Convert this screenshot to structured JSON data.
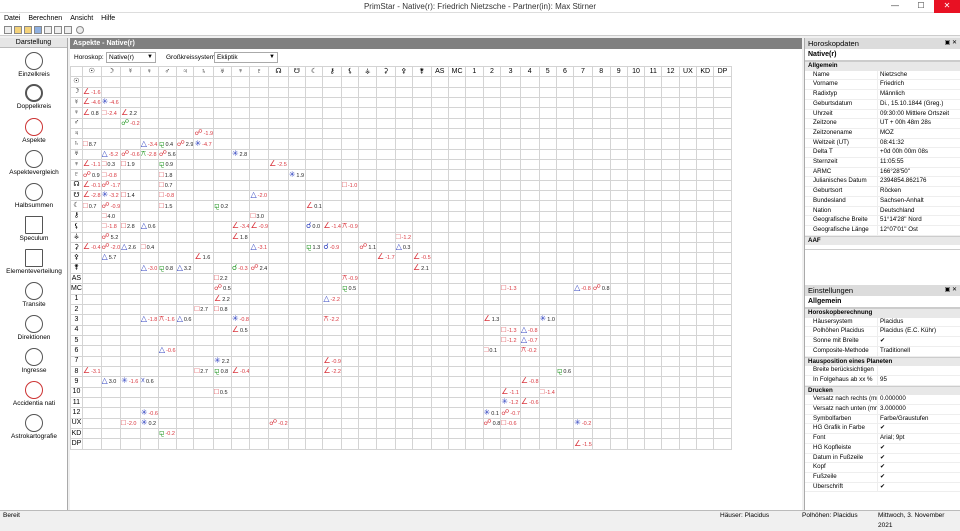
{
  "window": {
    "title": "PrimStar - Native(r): Friedrich Nietzsche - Partner(in): Max Stirner",
    "min": "—",
    "max": "☐",
    "close": "✕"
  },
  "menu": [
    "Datei",
    "Berechnen",
    "Ansicht",
    "Hilfe"
  ],
  "left": {
    "header": "Darstellung",
    "items": [
      {
        "label": "Einzelkreis",
        "icon": "single-circle-icon"
      },
      {
        "label": "Doppelkreis",
        "icon": "double-circle-icon"
      },
      {
        "label": "Aspekte",
        "icon": "aspects-icon"
      },
      {
        "label": "Aspektevergleich",
        "icon": "aspect-comparison-icon"
      },
      {
        "label": "Halbsummen",
        "icon": "midpoints-icon"
      },
      {
        "label": "Speculum",
        "icon": "speculum-icon"
      },
      {
        "label": "Elementeverteilung",
        "icon": "element-distribution-icon"
      },
      {
        "label": "Transite",
        "icon": "transits-icon"
      },
      {
        "label": "Direktionen",
        "icon": "directions-icon"
      },
      {
        "label": "Ingresse",
        "icon": "ingresses-icon"
      },
      {
        "label": "Accidentia nati",
        "icon": "accidentia-icon"
      },
      {
        "label": "Astrokartografie",
        "icon": "astrocartography-icon"
      }
    ]
  },
  "center": {
    "title": "Aspekte - Native(r)",
    "horoskop_label": "Horoskop:",
    "horoskop_value": "Native(r)",
    "kreis_label": "Großkreissystem:",
    "kreis_value": "Ekliptik",
    "col_headers": [
      "☉",
      "☽",
      "☿",
      "♀",
      "♂",
      "♃",
      "♄",
      "♅",
      "♆",
      "♇",
      "☊",
      "☋",
      "☾",
      "⚷",
      "⚸",
      "⚶",
      "⚳",
      "⚴",
      "⚵",
      "AS",
      "MC",
      "1",
      "2",
      "3",
      "4",
      "5",
      "6",
      "7",
      "8",
      "9",
      "10",
      "11",
      "12",
      "UX",
      "KD",
      "DP"
    ],
    "row_headers": [
      "☉",
      "☽",
      "☿",
      "♀",
      "♂",
      "♃",
      "♄",
      "♅",
      "♆",
      "♇",
      "☊",
      "☋",
      "☾",
      "⚷",
      "⚸",
      "⚶",
      "⚳",
      "⚴",
      "⚵",
      "AS",
      "MC",
      "1",
      "2",
      "3",
      "4",
      "5",
      "6",
      "7",
      "8",
      "9",
      "10",
      "11",
      "12",
      "UX",
      "KD",
      "DP"
    ],
    "cells": [
      [],
      [
        [
          0,
          "∠",
          "-1.6",
          "red"
        ]
      ],
      [
        [
          0,
          "∠",
          "-4.6",
          "red"
        ],
        [
          1,
          "✳",
          "-4.6",
          "blue"
        ]
      ],
      [
        [
          0,
          "∠",
          "0.8",
          "red"
        ],
        [
          1,
          "□",
          "-2.4",
          "red"
        ],
        [
          2,
          "∠",
          "2.2",
          "red"
        ]
      ],
      [
        [
          2,
          "☍",
          "-0.2",
          "green"
        ]
      ],
      [
        [
          6,
          "☍",
          "-1.9",
          "red"
        ]
      ],
      [
        [
          0,
          "□",
          "8.7",
          "red"
        ],
        [
          3,
          "△",
          "-3.4",
          "blue"
        ],
        [
          4,
          "⚼",
          "0.4",
          "green"
        ],
        [
          5,
          "☍",
          "2.9",
          "red"
        ],
        [
          6,
          "✳",
          "-4.7",
          "blue"
        ]
      ],
      [
        [
          1,
          "△",
          "-5.2",
          "blue"
        ],
        [
          2,
          "☍",
          "-0.6",
          "red"
        ],
        [
          3,
          "⚻",
          "-2.8",
          "green"
        ],
        [
          4,
          "☍",
          "5.6",
          "red"
        ],
        [
          8,
          "✳",
          "2.8",
          "blue"
        ]
      ],
      [
        [
          0,
          "∠",
          "-1.1",
          "red"
        ],
        [
          1,
          "□",
          "0.3",
          "red"
        ],
        [
          2,
          "□",
          "1.9",
          "red"
        ],
        [
          4,
          "⚼",
          "0.9",
          "green"
        ],
        [
          10,
          "∠",
          "-2.5",
          "red"
        ]
      ],
      [
        [
          0,
          "☍",
          "0.9",
          "red"
        ],
        [
          1,
          "□",
          "-0.8",
          "red"
        ],
        [
          4,
          "□",
          "1.8",
          "red"
        ],
        [
          11,
          "✳",
          "1.9",
          "blue"
        ]
      ],
      [
        [
          0,
          "∠",
          "-0.1",
          "red"
        ],
        [
          1,
          "☍",
          "-1.7",
          "red"
        ],
        [
          4,
          "□",
          "0.7",
          "red"
        ],
        [
          14,
          "□",
          "-1.0",
          "red"
        ]
      ],
      [
        [
          0,
          "∠",
          "-2.8",
          "red"
        ],
        [
          1,
          "✳",
          "-3.2",
          "blue"
        ],
        [
          2,
          "□",
          "1.4",
          "red"
        ],
        [
          4,
          "□",
          "-0.8",
          "red"
        ],
        [
          9,
          "△",
          "-2.0",
          "blue"
        ]
      ],
      [
        [
          0,
          "□",
          "0.7",
          "red"
        ],
        [
          1,
          "☍",
          "-0.9",
          "red"
        ],
        [
          4,
          "□",
          "1.5",
          "red"
        ],
        [
          7,
          "⚼",
          "0.2",
          "green"
        ],
        [
          12,
          "∠",
          "0.1",
          "red"
        ]
      ],
      [
        [
          1,
          "□",
          "4.0",
          "red"
        ],
        [
          9,
          "□",
          "3.0",
          "red"
        ]
      ],
      [
        [
          1,
          "□",
          "-1.8",
          "red"
        ],
        [
          2,
          "□",
          "2.8",
          "red"
        ],
        [
          3,
          "△",
          "0.6",
          "blue"
        ],
        [
          8,
          "∠",
          "-3.4",
          "red"
        ],
        [
          9,
          "∠",
          "-0.9",
          "red"
        ],
        [
          12,
          "☌",
          "0.0",
          "blue"
        ],
        [
          13,
          "∠",
          "-1.4",
          "red"
        ],
        [
          14,
          "⚻",
          "-0.9",
          "red"
        ]
      ],
      [
        [
          1,
          "☍",
          "5.2",
          "red"
        ],
        [
          8,
          "∠",
          "1.8",
          "red"
        ],
        [
          17,
          "□",
          "-1.2",
          "red"
        ]
      ],
      [
        [
          0,
          "∠",
          "-0.4",
          "red"
        ],
        [
          1,
          "☍",
          "-2.0",
          "red"
        ],
        [
          2,
          "△",
          "2.6",
          "blue"
        ],
        [
          3,
          "□",
          "0.4",
          "red"
        ],
        [
          9,
          "△",
          "-3.1",
          "blue"
        ],
        [
          12,
          "⚼",
          "1.3",
          "green"
        ],
        [
          13,
          "☌",
          "-0.9",
          "blue"
        ],
        [
          15,
          "☍",
          "1.1",
          "red"
        ],
        [
          17,
          "△",
          "0.3",
          "blue"
        ]
      ],
      [
        [
          1,
          "△",
          "5.7",
          "blue"
        ],
        [
          6,
          "∠",
          "1.6",
          "red"
        ],
        [
          16,
          "∠",
          "-1.7",
          "red"
        ],
        [
          18,
          "∠",
          "-0.5",
          "red"
        ]
      ],
      [
        [
          3,
          "△",
          "-3.0",
          "blue"
        ],
        [
          4,
          "⚼",
          "0.8",
          "green"
        ],
        [
          5,
          "△",
          "3.2",
          "blue"
        ],
        [
          8,
          "☌",
          "-0.3",
          "green"
        ],
        [
          9,
          "☍",
          "2.4",
          "red"
        ],
        [
          18,
          "∠",
          "2.1",
          "red"
        ]
      ],
      [
        [
          7,
          "□",
          "2.2",
          "red"
        ],
        [
          14,
          "⚻",
          "-0.9",
          "red"
        ]
      ],
      [
        [
          7,
          "☍",
          "0.5",
          "red"
        ],
        [
          14,
          "⚼",
          "0.5",
          "green"
        ],
        [
          23,
          "□",
          "-1.3",
          "red"
        ],
        [
          27,
          "△",
          "-0.8",
          "blue"
        ],
        [
          28,
          "☍",
          "0.8",
          "red"
        ]
      ],
      [
        [
          7,
          "∠",
          "2.2",
          "red"
        ],
        [
          13,
          "△",
          "-2.2",
          "blue"
        ]
      ],
      [
        [
          6,
          "□",
          "2.7",
          "red"
        ],
        [
          7,
          "□",
          "0.8",
          "red"
        ]
      ],
      [
        [
          3,
          "△",
          "-1.8",
          "blue"
        ],
        [
          4,
          "⚻",
          "-1.6",
          "red"
        ],
        [
          5,
          "△",
          "0.6",
          "blue"
        ],
        [
          8,
          "✳",
          "-0.8",
          "blue"
        ],
        [
          13,
          "⚻",
          "-2.2",
          "red"
        ],
        [
          22,
          "∠",
          "1.3",
          "red"
        ],
        [
          25,
          "✳",
          "1.0",
          "blue"
        ]
      ],
      [
        [
          8,
          "∠",
          "0.5",
          "red"
        ],
        [
          23,
          "□",
          "-1.3",
          "red"
        ],
        [
          24,
          "△",
          "-0.8",
          "blue"
        ]
      ],
      [
        [
          23,
          "□",
          "-1.2",
          "red"
        ],
        [
          24,
          "△",
          "-0.7",
          "blue"
        ]
      ],
      [
        [
          4,
          "△",
          "-0.6",
          "blue"
        ],
        [
          22,
          "□",
          "0.1",
          "red"
        ],
        [
          24,
          "⚻",
          "-0.2",
          "red"
        ]
      ],
      [
        [
          7,
          "✳",
          "2.2",
          "blue"
        ],
        [
          13,
          "∠",
          "-0.9",
          "red"
        ]
      ],
      [
        [
          0,
          "∠",
          "-3.1",
          "red"
        ],
        [
          6,
          "□",
          "2.7",
          "red"
        ],
        [
          7,
          "⚼",
          "0.8",
          "green"
        ],
        [
          8,
          "∠",
          "-0.4",
          "red"
        ],
        [
          13,
          "∠",
          "-2.2",
          "red"
        ],
        [
          26,
          "⚼",
          "0.6",
          "green"
        ]
      ],
      [
        [
          1,
          "△",
          "3.0",
          "blue"
        ],
        [
          2,
          "✳",
          "-1.6",
          "blue"
        ],
        [
          3,
          "☓",
          "0.6",
          "blue"
        ],
        [
          24,
          "∠",
          "-0.8",
          "red"
        ]
      ],
      [
        [
          7,
          "□",
          "0.5",
          "red"
        ],
        [
          23,
          "∠",
          "-1.1",
          "red"
        ],
        [
          25,
          "□",
          "-1.4",
          "red"
        ]
      ],
      [
        [
          23,
          "✳",
          "-1.2",
          "blue"
        ],
        [
          24,
          "∠",
          "-0.6",
          "red"
        ]
      ],
      [
        [
          3,
          "✳",
          "-0.6",
          "blue"
        ],
        [
          22,
          "✳",
          "0.1",
          "blue"
        ],
        [
          23,
          "☍",
          "-0.7",
          "red"
        ]
      ],
      [
        [
          2,
          "□",
          "-2.0",
          "red"
        ],
        [
          3,
          "✳",
          "0.2",
          "blue"
        ],
        [
          10,
          "☍",
          "-0.2",
          "red"
        ],
        [
          22,
          "☍",
          "0.8",
          "red"
        ],
        [
          23,
          "□",
          "-0.6",
          "red"
        ],
        [
          27,
          "✳",
          "-0.2",
          "blue"
        ]
      ],
      [
        [
          4,
          "⚼",
          "-0.2",
          "green"
        ]
      ],
      [
        [
          27,
          "∠",
          "-1.5",
          "red"
        ]
      ]
    ]
  },
  "horoscope": {
    "header": "Horoskopdaten",
    "sub": "Native(r)",
    "section": "Allgemein",
    "rows": [
      [
        "Name",
        "Nietzsche"
      ],
      [
        "Vorname",
        "Friedrich"
      ],
      [
        "Radixtyp",
        "Männlich"
      ],
      [
        "Geburtsdatum",
        "Di., 15.10.1844 (Greg.)"
      ],
      [
        "Uhrzeit",
        "09:30:00 Mittlere Ortszeit"
      ],
      [
        "Zeitzone",
        "UT + 00h 48m 28s"
      ],
      [
        "Zeitzonename",
        "MOZ"
      ],
      [
        "Weltzeit (UT)",
        "08:41:32"
      ],
      [
        "Delta T",
        "+0d 00h 00m 08s"
      ],
      [
        "Sternzeit",
        "11:05:55"
      ],
      [
        "ARMC",
        "166°28'50\""
      ],
      [
        "Julianisches Datum",
        "2394854.862176"
      ],
      [
        "Geburtsort",
        "Röcken"
      ],
      [
        "Bundesland",
        "Sachsen-Anhalt"
      ],
      [
        "Nation",
        "Deutschland"
      ],
      [
        "Geografische Breite",
        "51°14'28\" Nord"
      ],
      [
        "Geografische Länge",
        "12°07'01\" Ost"
      ]
    ],
    "more": "AAF"
  },
  "settings": {
    "header": "Einstellungen",
    "sub": "Allgemein",
    "sections": [
      {
        "title": "Horoskopberechnung",
        "rows": [
          [
            "Häusersystem",
            "Placidus"
          ],
          [
            "Polhöhen Placidus",
            "Placidus (E.C. Kühr)"
          ],
          [
            "Sonne mit Breite",
            "✔"
          ],
          [
            "Composite-Methode",
            "Traditionell"
          ]
        ]
      },
      {
        "title": "Hausposition eines Planeten",
        "rows": [
          [
            "Breite berücksichtigen",
            ""
          ],
          [
            "In Folgehaus ab xx %",
            "95"
          ]
        ]
      },
      {
        "title": "Drucken",
        "rows": [
          [
            "Versatz nach rechts (mm)",
            "0.000000"
          ],
          [
            "Versatz nach unten (mm)",
            "3.000000"
          ],
          [
            "Symbolfarben",
            "Farbe/Graustufen"
          ],
          [
            "HG Grafik in Farbe",
            "✔"
          ],
          [
            "Font",
            "Arial; 9pt"
          ],
          [
            "HG Kopfleiste",
            "✔"
          ],
          [
            "Datum in Fußzeile",
            "✔"
          ],
          [
            "Kopf",
            "✔"
          ],
          [
            "Fußzeile",
            "✔"
          ],
          [
            "Überschrift",
            "✔"
          ]
        ]
      }
    ]
  },
  "status": {
    "left": "Bereit",
    "houses": "Häuser: Placidus",
    "polhoehen": "Polhöhen: Placidus",
    "date": "Mittwoch, 3. November 2021"
  }
}
